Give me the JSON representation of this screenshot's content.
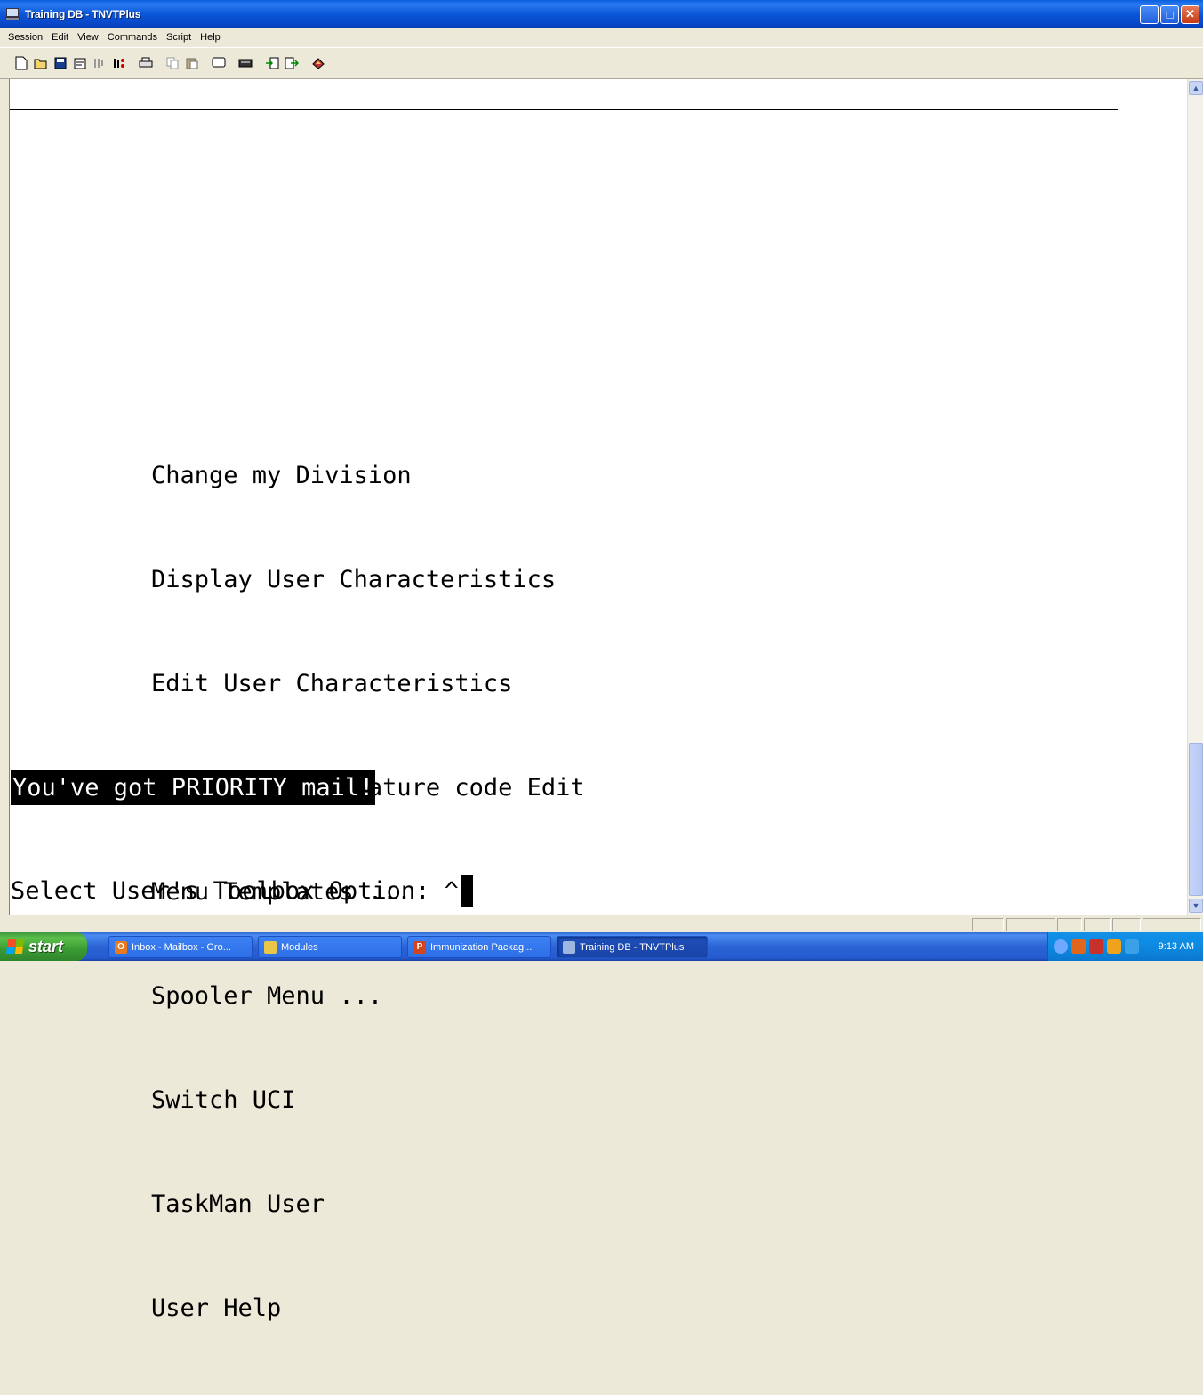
{
  "window": {
    "title": "Training DB - TNVTPlus",
    "controls": {
      "minimize": "_",
      "maximize": "□",
      "close": "✕"
    }
  },
  "menubar": [
    "Session",
    "Edit",
    "View",
    "Commands",
    "Script",
    "Help"
  ],
  "toolbar": {
    "icons": [
      "new-icon",
      "open-icon",
      "save-icon",
      "properties-icon",
      "connect-icon",
      "disconnect-icon",
      "print-icon",
      "copy-icon",
      "paste-icon",
      "screen-icon",
      "keyboard-icon",
      "receive-icon",
      "send-icon",
      "help-icon"
    ]
  },
  "terminal": {
    "menu_items": [
      "Change my Division",
      "Display User Characteristics",
      "Edit User Characteristics",
      "Electronic Signature code Edit",
      "Menu Templates ...",
      "Spooler Menu ...",
      "Switch UCI",
      "TaskMan User",
      "User Help"
    ],
    "priority_message": "You've got PRIORITY mail!",
    "prompt": "Select User's Toolbox Option: ^"
  },
  "taskbar": {
    "start_label": "start",
    "tasks": [
      {
        "label": "Inbox - Mailbox - Gro...",
        "icon": "outlook-icon",
        "color": "#e8791e"
      },
      {
        "label": "Modules",
        "icon": "folder-icon",
        "color": "#e9c54a"
      },
      {
        "label": "Immunization Packag...",
        "icon": "powerpoint-icon",
        "color": "#d2461f"
      },
      {
        "label": "Training DB - TNVTPlus",
        "icon": "terminal-icon",
        "color": "#9db8e0"
      }
    ],
    "clock": "9:13 AM"
  },
  "colors": {
    "title_bar": "#0b56d8",
    "terminal_bg": "#ffffff",
    "terminal_fg": "#000000",
    "taskbar": "#245cd0",
    "start_button": "#3a9b34"
  }
}
